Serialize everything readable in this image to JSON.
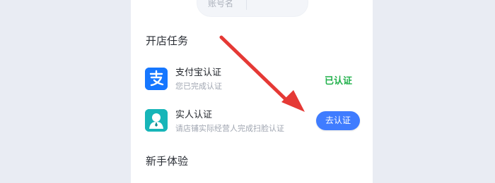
{
  "header": {
    "account_label": "账号名"
  },
  "sections": {
    "store_tasks": {
      "title": "开店任务",
      "items": [
        {
          "title": "支付宝认证",
          "subtitle": "您已完成认证",
          "status": "已认证",
          "icon": "alipay-icon"
        },
        {
          "title": "实人认证",
          "subtitle": "请店铺实际经营人完成扫脸认证",
          "action_label": "去认证",
          "icon": "person-avatar-icon"
        }
      ]
    },
    "new_user": {
      "title": "新手体验"
    }
  },
  "colors": {
    "accent": "#3f7cff",
    "success": "#22b14c",
    "alipay_blue": "#1677ff",
    "arrow_red": "#e53935"
  }
}
